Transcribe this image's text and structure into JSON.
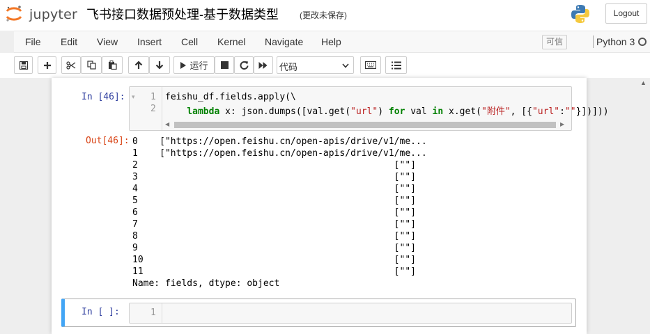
{
  "header": {
    "logo_text": "jupyter",
    "notebook_title": "飞书接口数据预处理-基于数据类型",
    "save_status": "(更改未保存)",
    "logout_label": "Logout"
  },
  "menubar": {
    "items": [
      "File",
      "Edit",
      "View",
      "Insert",
      "Cell",
      "Kernel",
      "Navigate",
      "Help"
    ],
    "trusted_label": "可信",
    "kernel_name": "Python 3"
  },
  "toolbar": {
    "run_label": "运行",
    "cell_type_value": "代码"
  },
  "cells": [
    {
      "prompt": "In  [46]:",
      "line_numbers": [
        "1",
        "2"
      ],
      "out_prompt": "Out[46]:",
      "output_lines": [
        "0    [\"https://open.feishu.cn/open-apis/drive/v1/me...",
        "1    [\"https://open.feishu.cn/open-apis/drive/v1/me...",
        "2                                               [\"\"]",
        "3                                               [\"\"]",
        "4                                               [\"\"]",
        "5                                               [\"\"]",
        "6                                               [\"\"]",
        "7                                               [\"\"]",
        "8                                               [\"\"]",
        "9                                               [\"\"]",
        "10                                              [\"\"]",
        "11                                              [\"\"]",
        "Name: fields, dtype: object"
      ]
    },
    {
      "prompt": "In  [ ]:",
      "line_numbers": [
        "1"
      ]
    }
  ],
  "code": {
    "line1": "feishu_df.fields.apply(\\",
    "line2_indent": "    ",
    "kw_lambda": "lambda",
    "line2_a": " x: json.dumps([val.get(",
    "str_url": "\"url\"",
    "line2_b": ") ",
    "kw_for": "for",
    "line2_c": " val ",
    "kw_in": "in",
    "line2_d": " x.get(",
    "str_attach": "\"附件\"",
    "line2_e": ", [{",
    "str_url2": "\"url\"",
    "line2_f": ":",
    "str_empty": "\"\"",
    "line2_g": "}])]))"
  }
}
